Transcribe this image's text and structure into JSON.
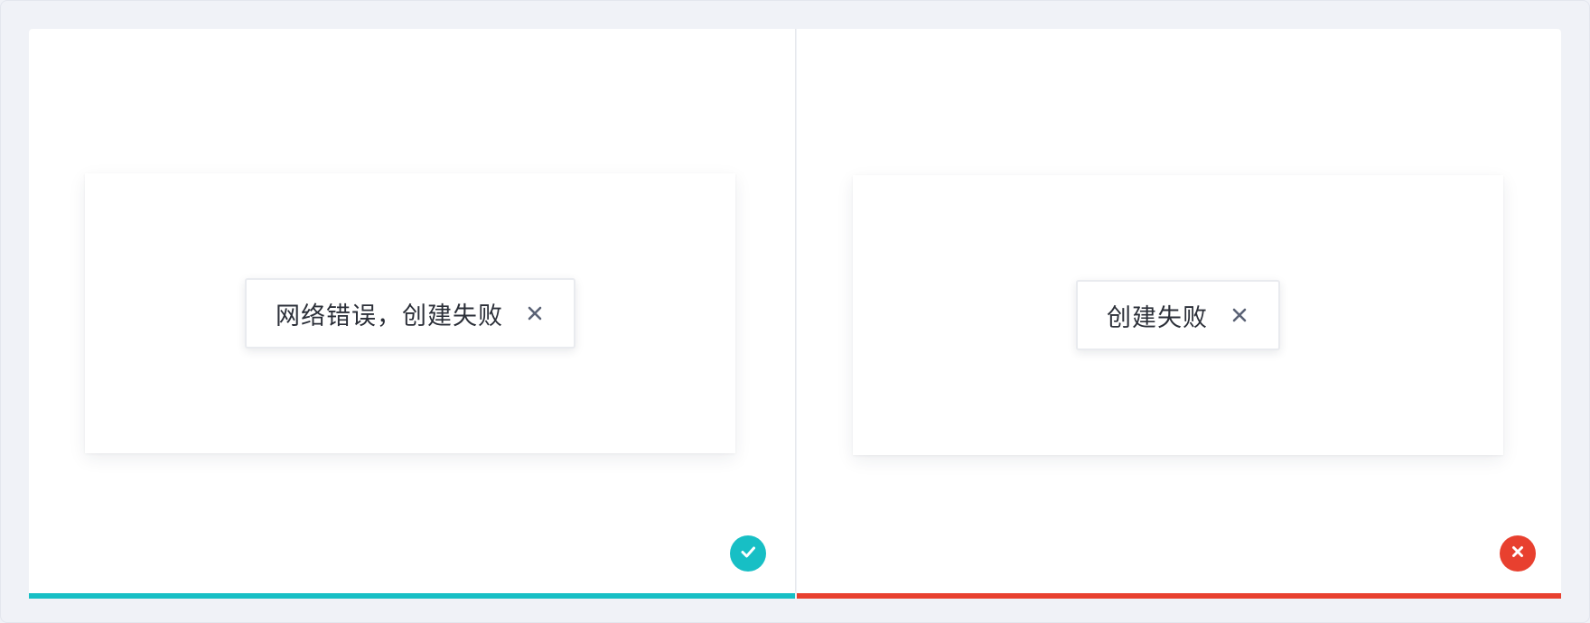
{
  "colors": {
    "good": "#17bfc5",
    "bad": "#e8402f",
    "icon_gray": "#5a6275"
  },
  "examples": [
    {
      "verdict": "correct",
      "badge_icon": "check-icon",
      "toast": {
        "message": "网络错误，创建失败",
        "close_icon": "close-icon"
      }
    },
    {
      "verdict": "incorrect",
      "badge_icon": "cross-icon",
      "toast": {
        "message": "创建失败",
        "close_icon": "close-icon"
      }
    }
  ]
}
